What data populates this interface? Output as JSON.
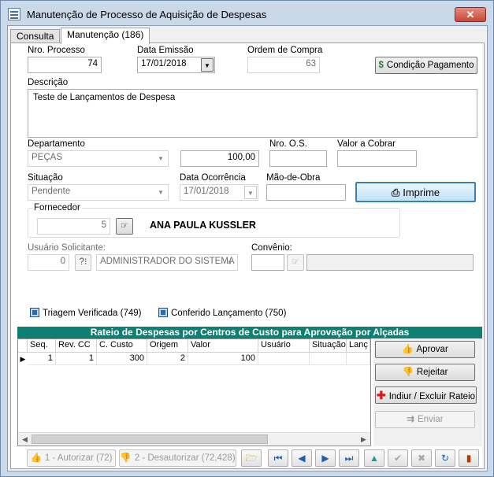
{
  "window": {
    "title": "Manutenção de Processo de Aquisição de Despesas",
    "close_label": "✕"
  },
  "tabs": [
    {
      "label": "Consulta"
    },
    {
      "label": "Manutenção (186)"
    }
  ],
  "form": {
    "nro_processo": {
      "label": "Nro. Processo",
      "value": "74"
    },
    "data_emissao": {
      "label": "Data Emissão",
      "value": "17/01/2018"
    },
    "ordem_compra": {
      "label": "Ordem de Compra",
      "value": "63"
    },
    "condicao_pagamento_label": "Condição Pagamento",
    "descricao": {
      "label": "Descrição",
      "value": "Teste de Lançamentos de Despesa"
    },
    "departamento": {
      "label": "Departamento",
      "value": "PEÇAS"
    },
    "valor_field": {
      "value": "100,00"
    },
    "nro_os": {
      "label": "Nro. O.S.",
      "value": ""
    },
    "valor_cobrar": {
      "label": "Valor a Cobrar",
      "value": ""
    },
    "situacao": {
      "label": "Situação",
      "value": "Pendente"
    },
    "data_ocorrencia": {
      "label": "Data Ocorrência",
      "value": "17/01/2018"
    },
    "mao_de_obra": {
      "label": "Mão-de-Obra",
      "value": ""
    },
    "imprime_label": "Imprime",
    "fornecedor": {
      "label": "Fornecedor",
      "code": "5",
      "name": "ANA PAULA KUSSLER"
    },
    "usuario_solicitante": {
      "label": "Usuário Solicitante:",
      "code": "0",
      "name": "ADMINISTRADOR DO SISTEMA"
    },
    "convenio": {
      "label": "Convênio:",
      "code": "",
      "name": ""
    },
    "triagem_verificada": "Triagem Verificada (749)",
    "conferido_lancamento": "Conferido Lançamento (750)"
  },
  "grid": {
    "title": "Rateio de Despesas por Centros de Custo para Aprovação por Alçadas",
    "columns": [
      "Seq.",
      "Rev. CC",
      "C. Custo",
      "Origem",
      "Valor",
      "Usuário",
      "Situação",
      "Lanç"
    ],
    "rows": [
      {
        "seq": "1",
        "rev_cc": "1",
        "c_custo": "300",
        "origem": "2",
        "valor": "100",
        "usuario": "",
        "situacao": "",
        "lanc": ""
      }
    ]
  },
  "side_buttons": {
    "aprovar": "Aprovar",
    "rejeitar": "Rejeitar",
    "incluir_excluir": "Indiur / Excluir Rateio",
    "enviar": "Enviar"
  },
  "bottom": {
    "autorizar": "1 - Autorizar (72)",
    "desautorizar": "2 - Desautorizar (72,428)"
  }
}
